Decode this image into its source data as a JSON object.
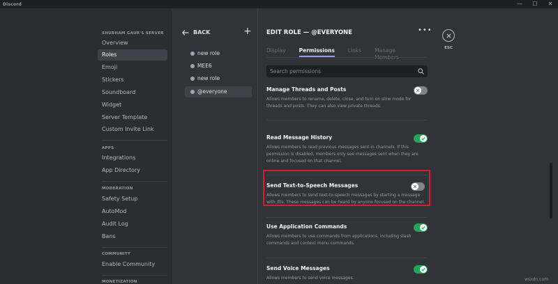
{
  "window": {
    "title": "Discord",
    "minimize": "—",
    "maximize": "☐",
    "close": "✕"
  },
  "sidebar": {
    "server_section": "SHUBHAM GAUR'S SERVER",
    "server_items": [
      {
        "label": "Overview"
      },
      {
        "label": "Roles",
        "active": true
      },
      {
        "label": "Emoji"
      },
      {
        "label": "Stickers"
      },
      {
        "label": "Soundboard"
      },
      {
        "label": "Widget"
      },
      {
        "label": "Server Template"
      },
      {
        "label": "Custom Invite Link"
      }
    ],
    "apps_section": "APPS",
    "apps_items": [
      {
        "label": "Integrations"
      },
      {
        "label": "App Directory"
      }
    ],
    "moderation_section": "MODERATION",
    "moderation_items": [
      {
        "label": "Safety Setup"
      },
      {
        "label": "AutoMod"
      },
      {
        "label": "Audit Log"
      },
      {
        "label": "Bans"
      }
    ],
    "community_section": "COMMUNITY",
    "community_items": [
      {
        "label": "Enable Community"
      }
    ],
    "monetization_section": "MONETIZATION"
  },
  "roles_panel": {
    "back_label": "BACK",
    "add_label": "+",
    "roles": [
      {
        "name": "new role"
      },
      {
        "name": "MEE6"
      },
      {
        "name": "new role"
      },
      {
        "name": "@everyone",
        "active": true
      }
    ]
  },
  "main": {
    "title": "EDIT ROLE — @EVERYONE",
    "more_label": "•••",
    "tabs": [
      {
        "label": "Display"
      },
      {
        "label": "Permissions",
        "active": true
      },
      {
        "label": "Links"
      },
      {
        "label": "Manage Members"
      }
    ],
    "search_placeholder": "Search permissions",
    "permissions": [
      {
        "title": "Manage Threads and Posts",
        "desc": "Allows members to rename, delete, close, and turn on slow mode for threads and posts. They can also view private threads.",
        "enabled": false
      },
      {
        "title": "Read Message History",
        "desc": "Allows members to read previous messages sent in channels. If this permission is disabled, members only see messages sent when they are online and focused on that channel.",
        "enabled": true
      },
      {
        "title": "Send Text-to-Speech Messages",
        "desc": "Allows members to send text-to-speech messages by starting a message with /tts. These messages can be heard by anyone focused on the channel.",
        "enabled": false
      },
      {
        "title": "Use Application Commands",
        "desc": "Allows members to use commands from applications, including slash commands and context menu commands.",
        "enabled": true
      },
      {
        "title": "Send Voice Messages",
        "desc": "Allows members to send voice messages.",
        "enabled": true
      }
    ]
  },
  "close": {
    "label": "ESC"
  },
  "watermark": "wsxdn.com",
  "colors": {
    "accent": "#949cf7",
    "toggle_on": "#23a55a",
    "toggle_off": "#80848e",
    "highlight": "#d6212c"
  }
}
